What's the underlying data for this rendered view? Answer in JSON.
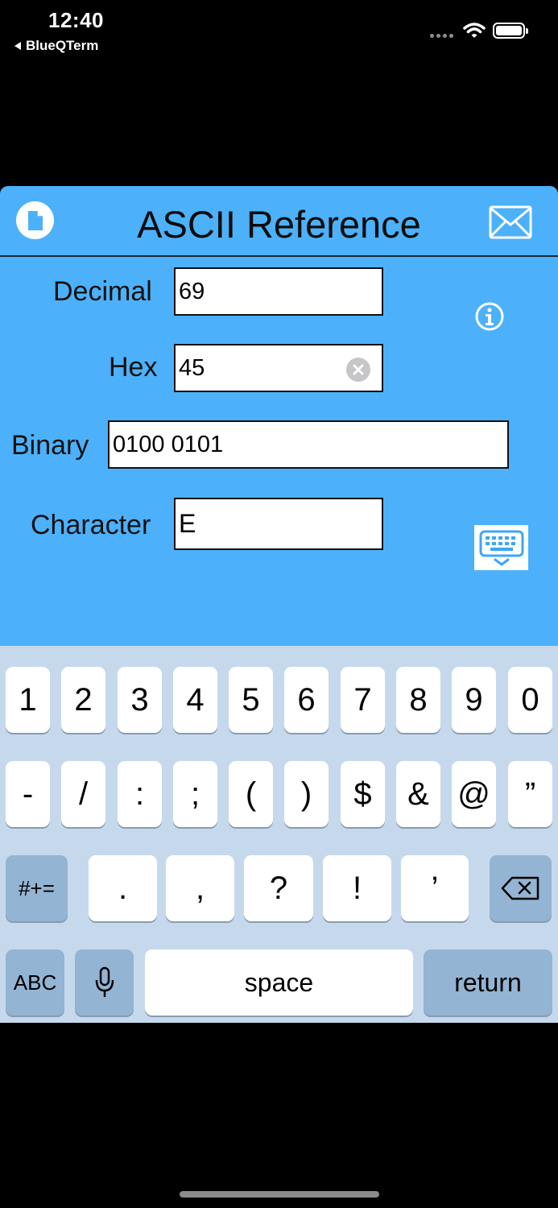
{
  "status_bar": {
    "time": "12:40",
    "back_app": "BlueQTerm",
    "icons": [
      "signal-dots-icon",
      "wifi-icon",
      "battery-icon"
    ]
  },
  "navbar": {
    "title": "ASCII Reference",
    "left_icon": "document-icon",
    "right_icon": "envelope-icon"
  },
  "fields": {
    "decimal": {
      "label": "Decimal",
      "value": "69"
    },
    "hex": {
      "label": "Hex",
      "value": "45"
    },
    "binary": {
      "label": "Binary",
      "value": "0100 0101"
    },
    "character": {
      "label": "Character",
      "value": "E"
    }
  },
  "keyboard": {
    "row1": [
      "1",
      "2",
      "3",
      "4",
      "5",
      "6",
      "7",
      "8",
      "9",
      "0"
    ],
    "row2": [
      "-",
      "/",
      ":",
      ";",
      "(",
      ")",
      "$",
      "&",
      "@",
      "”"
    ],
    "row3": {
      "shift_label": "#+=",
      "keys": [
        ".",
        ",",
        "?",
        "!",
        "’"
      ]
    },
    "row4": {
      "abc_label": "ABC",
      "space_label": "space",
      "return_label": "return"
    }
  },
  "colors": {
    "panel_bg": "#4cb1fa",
    "keyboard_bg": "#c6d9ec",
    "dark_key": "#93b4d3",
    "icon_blue": "#4cb1fa"
  }
}
